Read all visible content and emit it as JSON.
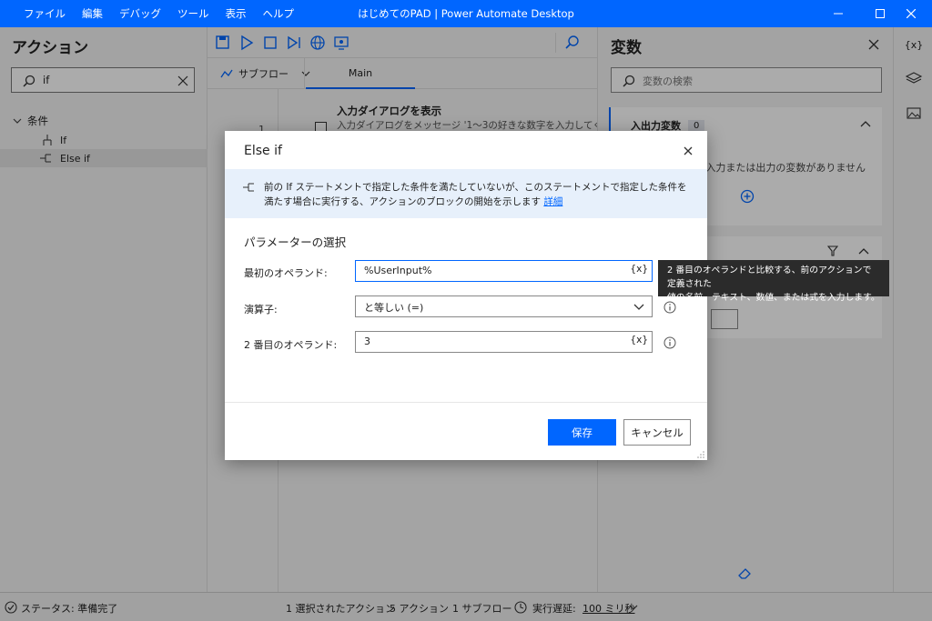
{
  "window": {
    "title": "はじめてのPAD | Power Automate Desktop",
    "menu": [
      "ファイル",
      "編集",
      "デバッグ",
      "ツール",
      "表示",
      "ヘルプ"
    ]
  },
  "actions_panel": {
    "title": "アクション",
    "search_value": "if",
    "category": "条件",
    "items": [
      "If",
      "Else if"
    ]
  },
  "designer": {
    "subflow_label": "サブフロー",
    "tab_main": "Main",
    "line_number": "1",
    "action_title": "入力ダイアログを表示",
    "action_desc": "入力ダイアログをメッセージ '1～3の好きな数字を入力してく"
  },
  "variables_panel": {
    "title": "変数",
    "search_placeholder": "変数の検索",
    "io_section_title": "入出力変数",
    "io_count": "0",
    "io_empty_message": "に入力または出力の変数がありません"
  },
  "status_bar": {
    "status": "ステータス: 準備完了",
    "selected": "1 選択されたアクション",
    "actions": "5 アクション",
    "subflows": "1 サブフロー",
    "delay_label": "実行遅延:",
    "delay_value": "100 ミリ秒"
  },
  "dialog": {
    "title": "Else if",
    "info_text": "前の If ステートメントで指定した条件を満たしていないが、このステートメントで指定した条件を満たす場合に実行する、アクションのブロックの開始を示します",
    "info_link": "詳細",
    "param_heading": "パラメーターの選択",
    "first_operand_label": "最初のオペランド:",
    "first_operand_value": "%UserInput%",
    "operator_label": "演算子:",
    "operator_value": "と等しい (=)",
    "second_operand_label": "2 番目のオペランド:",
    "second_operand_value": "3",
    "var_button": "{x}",
    "save_label": "保存",
    "cancel_label": "キャンセル"
  },
  "tooltip": {
    "line1": "2 番目のオペランドと比較する、前のアクションで定義された",
    "line2": "値の名前、テキスト、数値、または式を入力します。"
  },
  "rail": {
    "variables_icon_label": "{x}"
  },
  "colors": {
    "accent": "#0066ff",
    "titlebar": "#0066ff",
    "info_bg": "#e7f0fb",
    "tooltip_bg": "#2b2b2b"
  }
}
